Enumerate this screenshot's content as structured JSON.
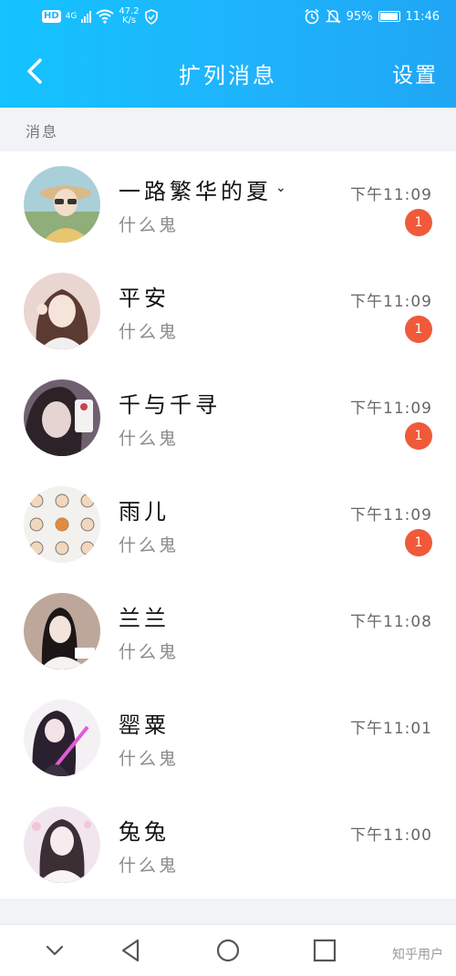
{
  "status_bar": {
    "network_badge": "HD",
    "network_type": "4G",
    "speed_value": "47.2",
    "speed_unit": "K/s",
    "battery": "95%",
    "time": "11:46"
  },
  "header": {
    "title": "扩列消息",
    "settings_label": "设置"
  },
  "section_label": "消息",
  "messages": [
    {
      "name": "一路繁华的夏",
      "has_chevron": true,
      "preview": "什么鬼",
      "time": "下午11:09",
      "unread": "1"
    },
    {
      "name": "平安",
      "preview": "什么鬼",
      "time": "下午11:09",
      "unread": "1"
    },
    {
      "name": "千与千寻",
      "preview": "什么鬼",
      "time": "下午11:09",
      "unread": "1"
    },
    {
      "name": "雨儿",
      "preview": "什么鬼",
      "time": "下午11:09",
      "unread": "1"
    },
    {
      "name": "兰兰",
      "preview": "什么鬼",
      "time": "下午11:08",
      "unread": ""
    },
    {
      "name": "罂粟",
      "preview": "什么鬼",
      "time": "下午11:01",
      "unread": ""
    },
    {
      "name": "兔兔",
      "preview": "什么鬼",
      "time": "下午11:00",
      "unread": ""
    }
  ],
  "watermark": "知乎用户",
  "colors": {
    "header_gradient_start": "#14c3ff",
    "header_gradient_end": "#1fa6f5",
    "unread_badge": "#f05a3a",
    "section_bg": "#f2f3f7"
  }
}
